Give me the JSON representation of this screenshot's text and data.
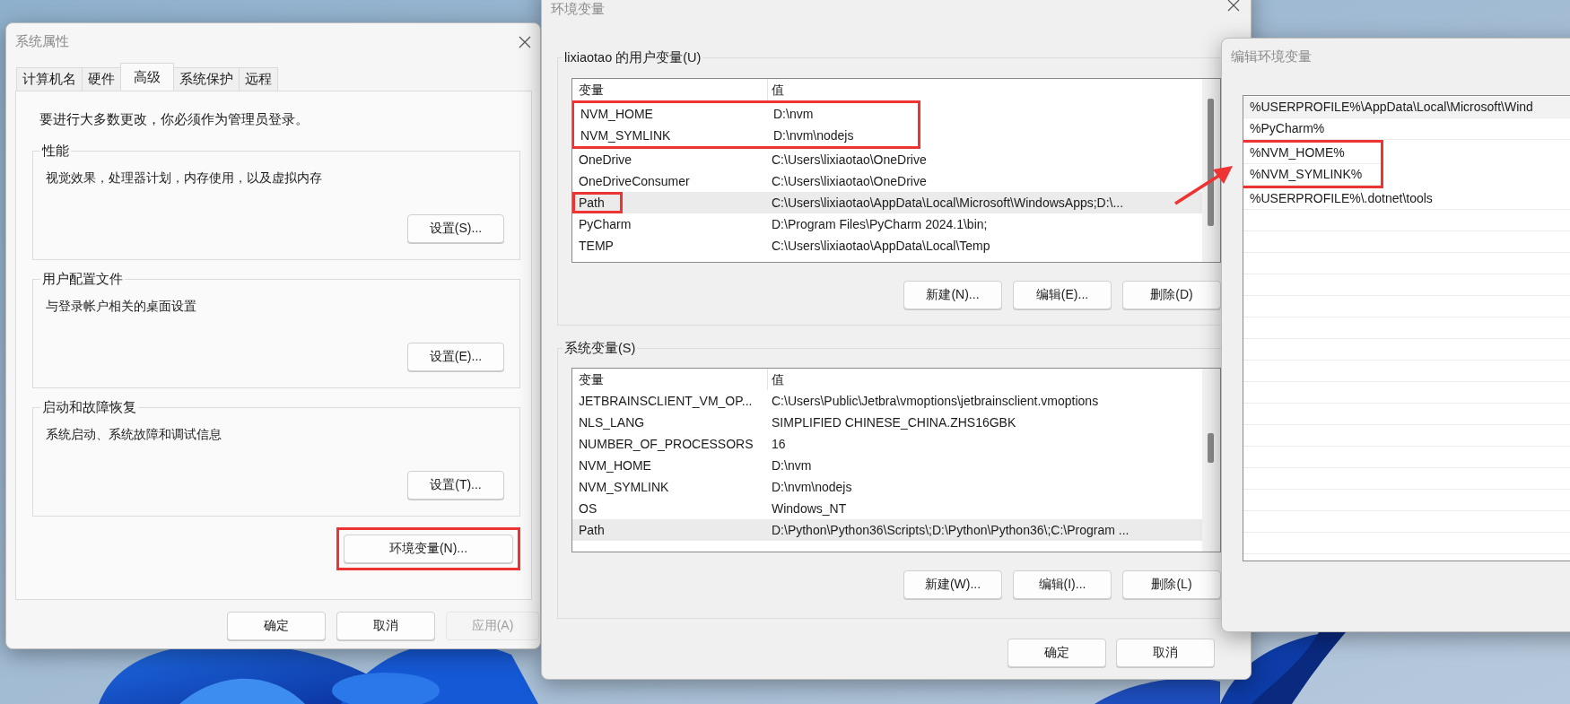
{
  "desktop": {
    "annotation_arrow": true
  },
  "system_properties": {
    "title": "系统属性",
    "tabs": [
      {
        "label": "计算机名",
        "selected": false
      },
      {
        "label": "硬件",
        "selected": false
      },
      {
        "label": "高级",
        "selected": true
      },
      {
        "label": "系统保护",
        "selected": false
      },
      {
        "label": "远程",
        "selected": false
      }
    ],
    "notice": "要进行大多数更改，你必须作为管理员登录。",
    "groups": [
      {
        "title": "性能",
        "description": "视觉效果，处理器计划，内存使用，以及虚拟内存",
        "button": "设置(S)..."
      },
      {
        "title": "用户配置文件",
        "description": "与登录帐户相关的桌面设置",
        "button": "设置(E)..."
      },
      {
        "title": "启动和故障恢复",
        "description": "系统启动、系统故障和调试信息",
        "button": "设置(T)..."
      }
    ],
    "env_button": {
      "label": "环境变量(N)...",
      "annotated": true
    },
    "footer_buttons": [
      {
        "label": "确定",
        "disabled": false
      },
      {
        "label": "取消",
        "disabled": false
      },
      {
        "label": "应用(A)",
        "disabled": true
      }
    ]
  },
  "environment_variables": {
    "title": "环境变量",
    "user_group": {
      "title": "lixiaotao 的用户变量(U)",
      "columns": [
        "变量",
        "值"
      ],
      "rows": [
        {
          "name": "NVM_HOME",
          "value": "D:\\nvm",
          "selected": false,
          "boxed": true,
          "name_boxed": false
        },
        {
          "name": "NVM_SYMLINK",
          "value": "D:\\nvm\\nodejs",
          "selected": false,
          "boxed": true,
          "name_boxed": false
        },
        {
          "name": "OneDrive",
          "value": "C:\\Users\\lixiaotao\\OneDrive",
          "selected": false,
          "boxed": false,
          "name_boxed": false
        },
        {
          "name": "OneDriveConsumer",
          "value": "C:\\Users\\lixiaotao\\OneDrive",
          "selected": false,
          "boxed": false,
          "name_boxed": false
        },
        {
          "name": "Path",
          "value": "C:\\Users\\lixiaotao\\AppData\\Local\\Microsoft\\WindowsApps;D:\\...",
          "selected": true,
          "boxed": false,
          "name_boxed": true
        },
        {
          "name": "PyCharm",
          "value": "D:\\Program Files\\PyCharm 2024.1\\bin;",
          "selected": false,
          "boxed": false,
          "name_boxed": false
        },
        {
          "name": "TEMP",
          "value": "C:\\Users\\lixiaotao\\AppData\\Local\\Temp",
          "selected": false,
          "boxed": false,
          "name_boxed": false
        }
      ],
      "buttons": [
        "新建(N)...",
        "编辑(E)...",
        "删除(D)"
      ]
    },
    "system_group": {
      "title": "系统变量(S)",
      "columns": [
        "变量",
        "值"
      ],
      "rows": [
        {
          "name": "JETBRAINSCLIENT_VM_OP...",
          "value": "C:\\Users\\Public\\Jetbra\\vmoptions\\jetbrainsclient.vmoptions",
          "selected": false,
          "boxed": false,
          "name_boxed": false
        },
        {
          "name": "NLS_LANG",
          "value": "SIMPLIFIED CHINESE_CHINA.ZHS16GBK",
          "selected": false,
          "boxed": false,
          "name_boxed": false
        },
        {
          "name": "NUMBER_OF_PROCESSORS",
          "value": "16",
          "selected": false,
          "boxed": false,
          "name_boxed": false
        },
        {
          "name": "NVM_HOME",
          "value": "D:\\nvm",
          "selected": false,
          "boxed": false,
          "name_boxed": false
        },
        {
          "name": "NVM_SYMLINK",
          "value": "D:\\nvm\\nodejs",
          "selected": false,
          "boxed": false,
          "name_boxed": false
        },
        {
          "name": "OS",
          "value": "Windows_NT",
          "selected": false,
          "boxed": false,
          "name_boxed": false
        },
        {
          "name": "Path",
          "value": "D:\\Python\\Python36\\Scripts\\;D:\\Python\\Python36\\;C:\\Program ...",
          "selected": true,
          "boxed": false,
          "name_boxed": false
        }
      ],
      "buttons": [
        "新建(W)...",
        "编辑(I)...",
        "删除(L)"
      ]
    },
    "footer_buttons": [
      "确定",
      "取消"
    ]
  },
  "edit_dialog": {
    "title": "编辑环境变量",
    "entries": [
      {
        "text": "%USERPROFILE%\\AppData\\Local\\Microsoft\\Wind",
        "selected": true,
        "boxed": false
      },
      {
        "text": "%PyCharm%",
        "selected": false,
        "boxed": false
      },
      {
        "text": "%NVM_HOME%",
        "selected": false,
        "boxed": true
      },
      {
        "text": "%NVM_SYMLINK%",
        "selected": false,
        "boxed": true
      },
      {
        "text": "%USERPROFILE%\\.dotnet\\tools",
        "selected": false,
        "boxed": false
      }
    ]
  }
}
